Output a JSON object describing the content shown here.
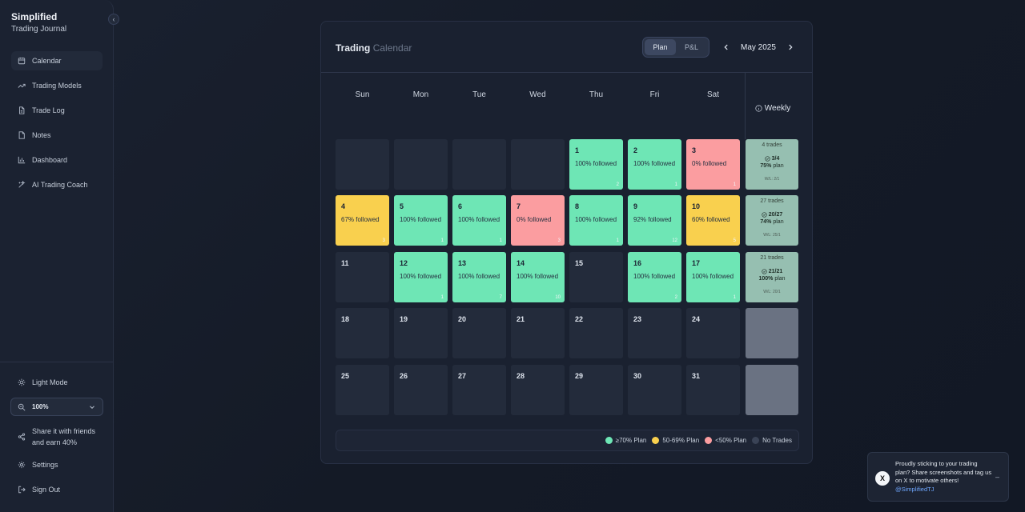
{
  "sidebar": {
    "brand_title": "Simplified",
    "brand_sub": "Trading Journal",
    "collapse_icon": "‹",
    "nav": [
      {
        "label": "Calendar",
        "icon": "calendar-icon",
        "active": true
      },
      {
        "label": "Trading Models",
        "icon": "trend-up-icon"
      },
      {
        "label": "Trade Log",
        "icon": "document-icon"
      },
      {
        "label": "Notes",
        "icon": "note-icon"
      },
      {
        "label": "Dashboard",
        "icon": "bar-chart-icon"
      },
      {
        "label": "AI Trading Coach",
        "icon": "sparkle-icon"
      }
    ],
    "light_mode": "Light Mode",
    "zoom": "100%",
    "share_line1": "Share it with friends",
    "share_line2": "and earn 40%",
    "settings": "Settings",
    "sign_out": "Sign Out"
  },
  "calendar": {
    "title_bold": "Trading",
    "title_muted": "Calendar",
    "toggle": [
      "Plan",
      "P&L"
    ],
    "toggle_selected": "Plan",
    "month": "May 2025",
    "prev_icon": "chevron-left-icon",
    "next_icon": "chevron-right-icon",
    "days": [
      "Sun",
      "Mon",
      "Tue",
      "Wed",
      "Thu",
      "Fri",
      "Sat"
    ],
    "weekly_label": "Weekly",
    "weeks": [
      {
        "cells": [
          {
            "day": "",
            "status": "empty"
          },
          {
            "day": "",
            "status": "empty"
          },
          {
            "day": "",
            "status": "empty"
          },
          {
            "day": "",
            "status": "empty"
          },
          {
            "day": "1",
            "status": "green",
            "pct": "100% followed",
            "count": "2"
          },
          {
            "day": "2",
            "status": "green",
            "pct": "100% followed",
            "count": "1"
          },
          {
            "day": "3",
            "status": "red",
            "pct": "0% followed",
            "count": "1"
          }
        ],
        "weekly": {
          "trades": "4 trades",
          "ratio": "3/4",
          "plan_pct": "75%",
          "plan_word": "plan",
          "wl": "W/L: 2/1"
        }
      },
      {
        "cells": [
          {
            "day": "4",
            "status": "yellow",
            "pct": "67% followed",
            "count": "3"
          },
          {
            "day": "5",
            "status": "green",
            "pct": "100% followed",
            "count": "1"
          },
          {
            "day": "6",
            "status": "green",
            "pct": "100% followed",
            "count": "1"
          },
          {
            "day": "7",
            "status": "red",
            "pct": "0% followed",
            "count": "3"
          },
          {
            "day": "8",
            "status": "green",
            "pct": "100% followed",
            "count": "1"
          },
          {
            "day": "9",
            "status": "green",
            "pct": "92% followed",
            "count": "12"
          },
          {
            "day": "10",
            "status": "yellow",
            "pct": "60% followed",
            "count": "5"
          }
        ],
        "weekly": {
          "trades": "27 trades",
          "ratio": "20/27",
          "plan_pct": "74%",
          "plan_word": "plan",
          "wl": "W/L: 25/1"
        }
      },
      {
        "cells": [
          {
            "day": "11",
            "status": "none"
          },
          {
            "day": "12",
            "status": "green",
            "pct": "100% followed",
            "count": "1"
          },
          {
            "day": "13",
            "status": "green",
            "pct": "100% followed",
            "count": "7"
          },
          {
            "day": "14",
            "status": "green",
            "pct": "100% followed",
            "count": "10"
          },
          {
            "day": "15",
            "status": "none"
          },
          {
            "day": "16",
            "status": "green",
            "pct": "100% followed",
            "count": "2"
          },
          {
            "day": "17",
            "status": "green",
            "pct": "100% followed",
            "count": "1"
          }
        ],
        "weekly": {
          "trades": "21 trades",
          "ratio": "21/21",
          "plan_pct": "100%",
          "plan_word": "plan",
          "wl": "W/L: 20/1"
        }
      },
      {
        "cells": [
          {
            "day": "18",
            "status": "none"
          },
          {
            "day": "19",
            "status": "none"
          },
          {
            "day": "20",
            "status": "none"
          },
          {
            "day": "21",
            "status": "none"
          },
          {
            "day": "22",
            "status": "none"
          },
          {
            "day": "23",
            "status": "none"
          },
          {
            "day": "24",
            "status": "none"
          }
        ],
        "weekly": null
      },
      {
        "cells": [
          {
            "day": "25",
            "status": "none"
          },
          {
            "day": "26",
            "status": "none"
          },
          {
            "day": "27",
            "status": "none"
          },
          {
            "day": "28",
            "status": "none"
          },
          {
            "day": "29",
            "status": "none"
          },
          {
            "day": "30",
            "status": "none"
          },
          {
            "day": "31",
            "status": "none"
          }
        ],
        "weekly": null
      }
    ],
    "legend": [
      {
        "label": "≥70% Plan",
        "color": "#6ee6b5"
      },
      {
        "label": "50-69% Plan",
        "color": "#f9d04e"
      },
      {
        "label": "<50% Plan",
        "color": "#fb9da0"
      },
      {
        "label": "No Trades",
        "color": "#3a4356"
      }
    ]
  },
  "toast": {
    "icon": "x-logo-icon",
    "logo_text": "X",
    "message": "Proudly sticking to your trading plan? Share screenshots and tag us on X to motivate others!",
    "handle": "@SimplifiedTJ",
    "dismiss": "–"
  }
}
